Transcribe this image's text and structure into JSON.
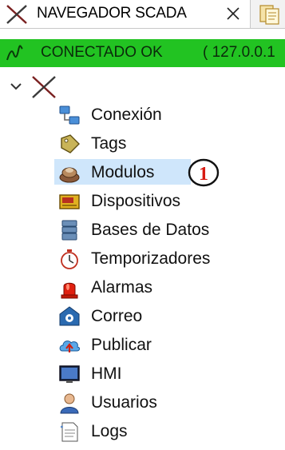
{
  "tab": {
    "title": "NAVEGADOR SCADA"
  },
  "status": {
    "text": "CONECTADO OK",
    "ip": "( 127.0.0.1"
  },
  "tree": {
    "items": [
      {
        "label": "Conexión",
        "icon": "connection-icon"
      },
      {
        "label": "Tags",
        "icon": "tag-icon"
      },
      {
        "label": "Modulos",
        "icon": "modules-icon",
        "selected": true
      },
      {
        "label": "Dispositivos",
        "icon": "devices-icon"
      },
      {
        "label": "Bases de Datos",
        "icon": "database-icon"
      },
      {
        "label": "Temporizadores",
        "icon": "timer-icon"
      },
      {
        "label": "Alarmas",
        "icon": "alarm-icon"
      },
      {
        "label": "Correo",
        "icon": "mail-icon"
      },
      {
        "label": "Publicar",
        "icon": "publish-icon"
      },
      {
        "label": "HMI",
        "icon": "monitor-icon"
      },
      {
        "label": "Usuarios",
        "icon": "user-icon"
      },
      {
        "label": "Logs",
        "icon": "logs-icon"
      }
    ]
  },
  "annotation": {
    "number": "1"
  },
  "colors": {
    "status_bg": "#22c322",
    "selection": "#cfe6fb",
    "badge_red": "#d81b12"
  }
}
